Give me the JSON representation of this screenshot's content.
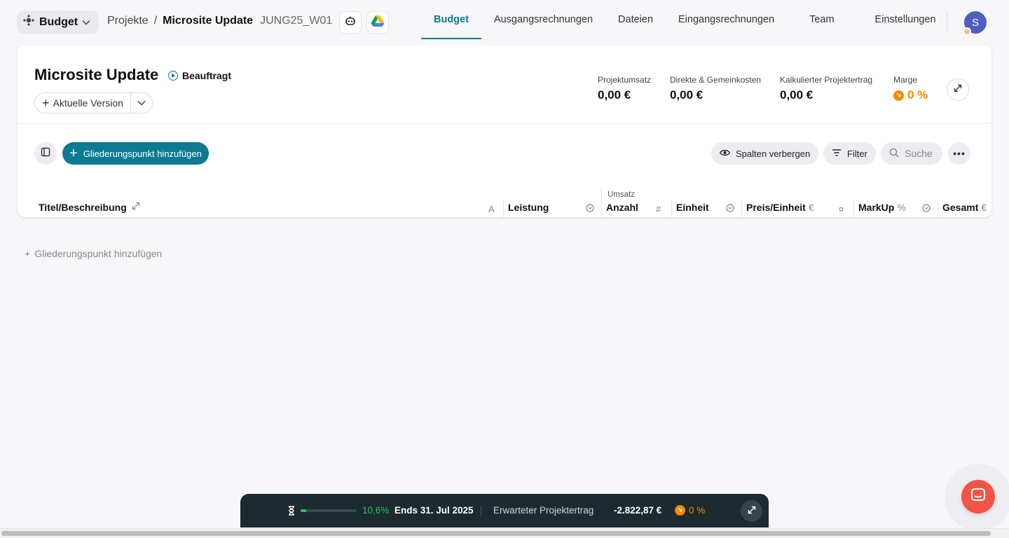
{
  "header": {
    "module_label": "Budget",
    "breadcrumb_root": "Projekte",
    "breadcrumb_sep": "/",
    "project_name": "Microsite Update",
    "project_code": "JUNG25_W01",
    "tabs": [
      {
        "label": "Budget",
        "active": true
      },
      {
        "label": "Ausgangsrechnungen",
        "active": false
      },
      {
        "label": "Dateien",
        "active": false
      },
      {
        "label": "Eingangsrechnungen",
        "active": false
      },
      {
        "label": "Team",
        "active": false
      },
      {
        "label": "Einstellungen",
        "active": false
      }
    ],
    "avatar_initial": "S"
  },
  "project": {
    "title": "Microsite Update",
    "status": "Beauftragt",
    "version_label": "Aktuelle Version",
    "metrics": [
      {
        "label": "Projektumsatz",
        "value": "0,00 €"
      },
      {
        "label": "Direkte & Gemeinkosten",
        "value": "0,00 €"
      },
      {
        "label": "Kalkulierter Projektertrag",
        "value": "0,00 €"
      },
      {
        "label": "Marge",
        "value": "0 %"
      }
    ]
  },
  "toolbar": {
    "add_outline": "Gliederungspunkt hinzufügen",
    "hide_columns": "Spalten verbergen",
    "filter": "Filter",
    "search_placeholder": "Suche"
  },
  "table": {
    "group_label": "Umsatz",
    "columns": {
      "title": "Titel/Beschreibung",
      "title_icon": "A",
      "leistung": "Leistung",
      "anzahl": "Anzahl",
      "anzahl_icon": "#",
      "einheit": "Einheit",
      "preis": "Preis/Einheit",
      "preis_unit": "€",
      "preis_icon": "¤",
      "markup": "MarkUp",
      "markup_unit": "%",
      "gesamt": "Gesamt",
      "gesamt_unit": "€"
    },
    "add_row_label": "Gliederungspunkt hinzufügen"
  },
  "bottom_bar": {
    "progress_pct": 10.6,
    "progress_label": "10,6%",
    "ends_label": "Ends 31. Jul 2025",
    "expected_label": "Erwarteter Projektertrag",
    "expected_value": "-2.822,87 €",
    "marge_value": "0 %"
  },
  "colors": {
    "accent": "#0d7a91",
    "warning": "#f08c00",
    "success": "#22c55e",
    "chat": "#f25447",
    "bottom_bar": "#1d2a2f"
  },
  "icons": [
    "module-icon",
    "chevron-down-icon",
    "robot-icon",
    "google-drive-icon",
    "expand-icon",
    "play-circle-icon",
    "plus-icon",
    "sidebar-toggle-icon",
    "eye-icon",
    "filter-icon",
    "search-icon",
    "more-icon",
    "hourglass-icon",
    "chat-icon"
  ]
}
